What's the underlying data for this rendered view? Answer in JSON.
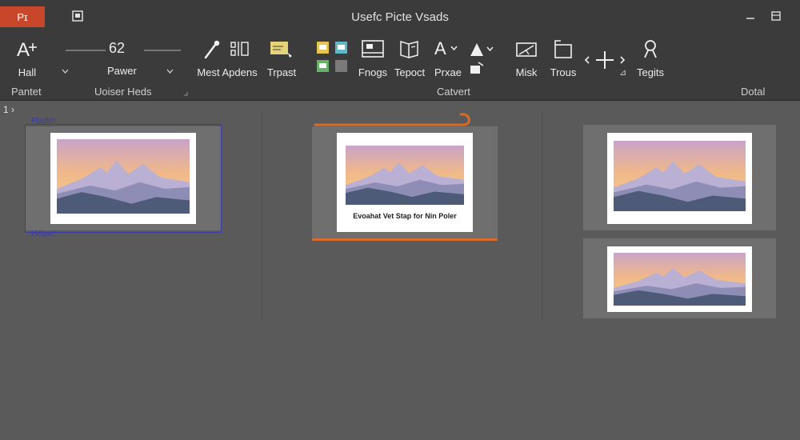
{
  "titlebar": {
    "app_badge": "Pɪ",
    "title": "Usefc Picte Vsads",
    "icons": [
      "doc-icon",
      "minimize-icon",
      "restore-icon"
    ]
  },
  "ribbon": {
    "tools": {
      "hall": "Hall",
      "zoom_value": "62",
      "zoom_label": "Pawer",
      "mest_apdens": "Mest Apdens",
      "trpast": "Trpast",
      "fnogs": "Fnogs",
      "tepoct": "Tepoct",
      "prxae": "Prxae",
      "misk": "Misk",
      "trous": "Trous",
      "tegits": "Tegits"
    },
    "groups": {
      "pantet": "Pantet",
      "uoiser_heds": "Uoiser Heds",
      "catvert": "Catvert",
      "dotal": "Dotal"
    }
  },
  "canvas": {
    "ruler_mark": "1 ›",
    "selected_top_label": "Plazlet",
    "selected_bottom_label": "Helpet",
    "caption": "Evoahat Vet Stap for Nin Poler"
  },
  "colors": {
    "accent_orange": "#d86a2a",
    "selection_blue": "#3a3aa8",
    "app_badge": "#c8472b"
  }
}
